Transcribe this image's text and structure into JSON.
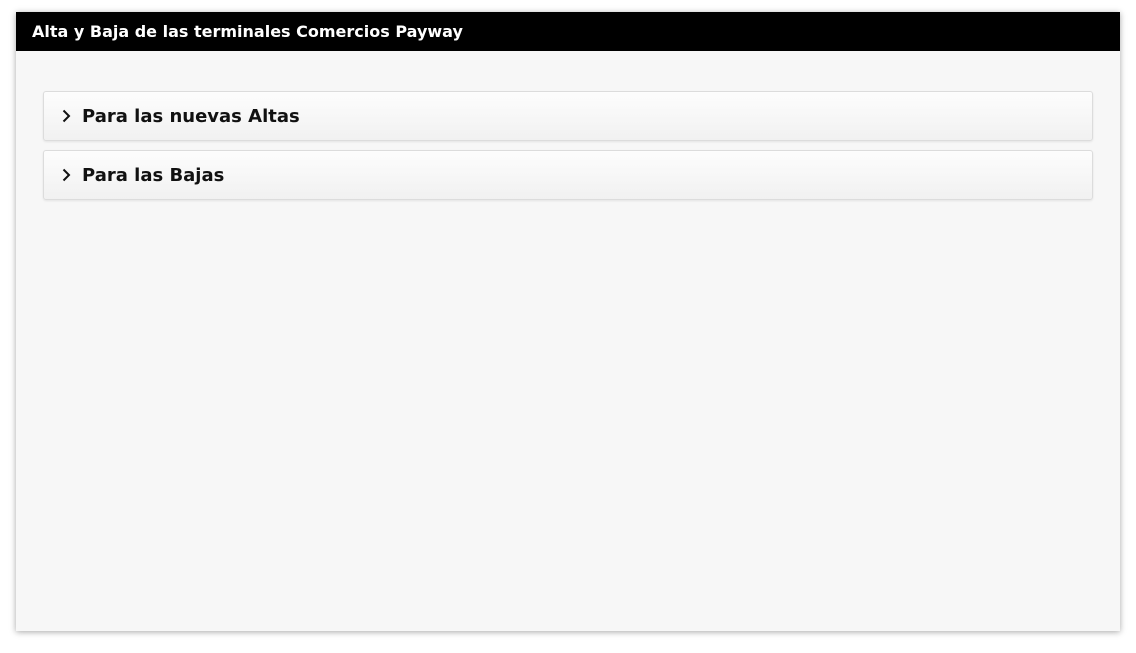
{
  "window": {
    "title": "Alta y Baja de las terminales Comercios Payway"
  },
  "accordion": {
    "items": [
      {
        "label": "Para las nuevas Altas",
        "icon": "chevron-right-icon",
        "expanded": false
      },
      {
        "label": "Para las Bajas",
        "icon": "chevron-right-icon",
        "expanded": false
      }
    ]
  },
  "colors": {
    "title_bar_bg": "#000000",
    "title_bar_text": "#ffffff",
    "panel_bg": "#f7f7f7"
  }
}
